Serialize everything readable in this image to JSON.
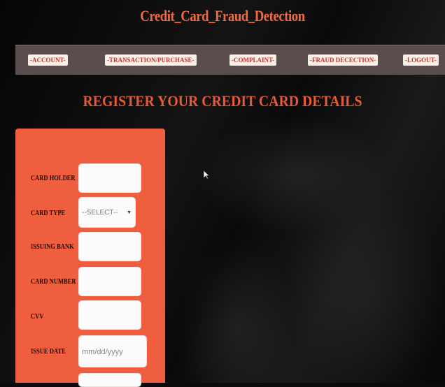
{
  "site": {
    "title": "Credit_Card_Fraud_Detection"
  },
  "nav": {
    "items": [
      {
        "label": "-ACCOUNT-"
      },
      {
        "label": "-TRANSACTION/PURCHASE-"
      },
      {
        "label": "-COMPLAINT-"
      },
      {
        "label": "-FRAUD DECECTION-"
      },
      {
        "label": "-LOGOUT-"
      }
    ]
  },
  "page": {
    "heading": "REGISTER YOUR CREDIT CARD DETAILS"
  },
  "form": {
    "card_holder": {
      "label": "CARD HOLDER",
      "value": ""
    },
    "card_type": {
      "label": "CARD TYPE",
      "selected": "--SELECT--"
    },
    "issuing_bank": {
      "label": "ISSUING BANK",
      "value": ""
    },
    "card_number": {
      "label": "CARD NUMBER",
      "value": ""
    },
    "cvv": {
      "label": "CVV",
      "value": ""
    },
    "issue_date": {
      "label": "ISSUE DATE",
      "placeholder": "mm/dd/yyyy"
    }
  },
  "colors": {
    "title": "#f2693f",
    "navbar": "#5b4d4d",
    "nav_text": "#c2352a",
    "panel": "#ef5e3f"
  },
  "icons": {
    "pointer": "mouse-pointer-icon",
    "dropdown": "chevron-down-icon"
  }
}
